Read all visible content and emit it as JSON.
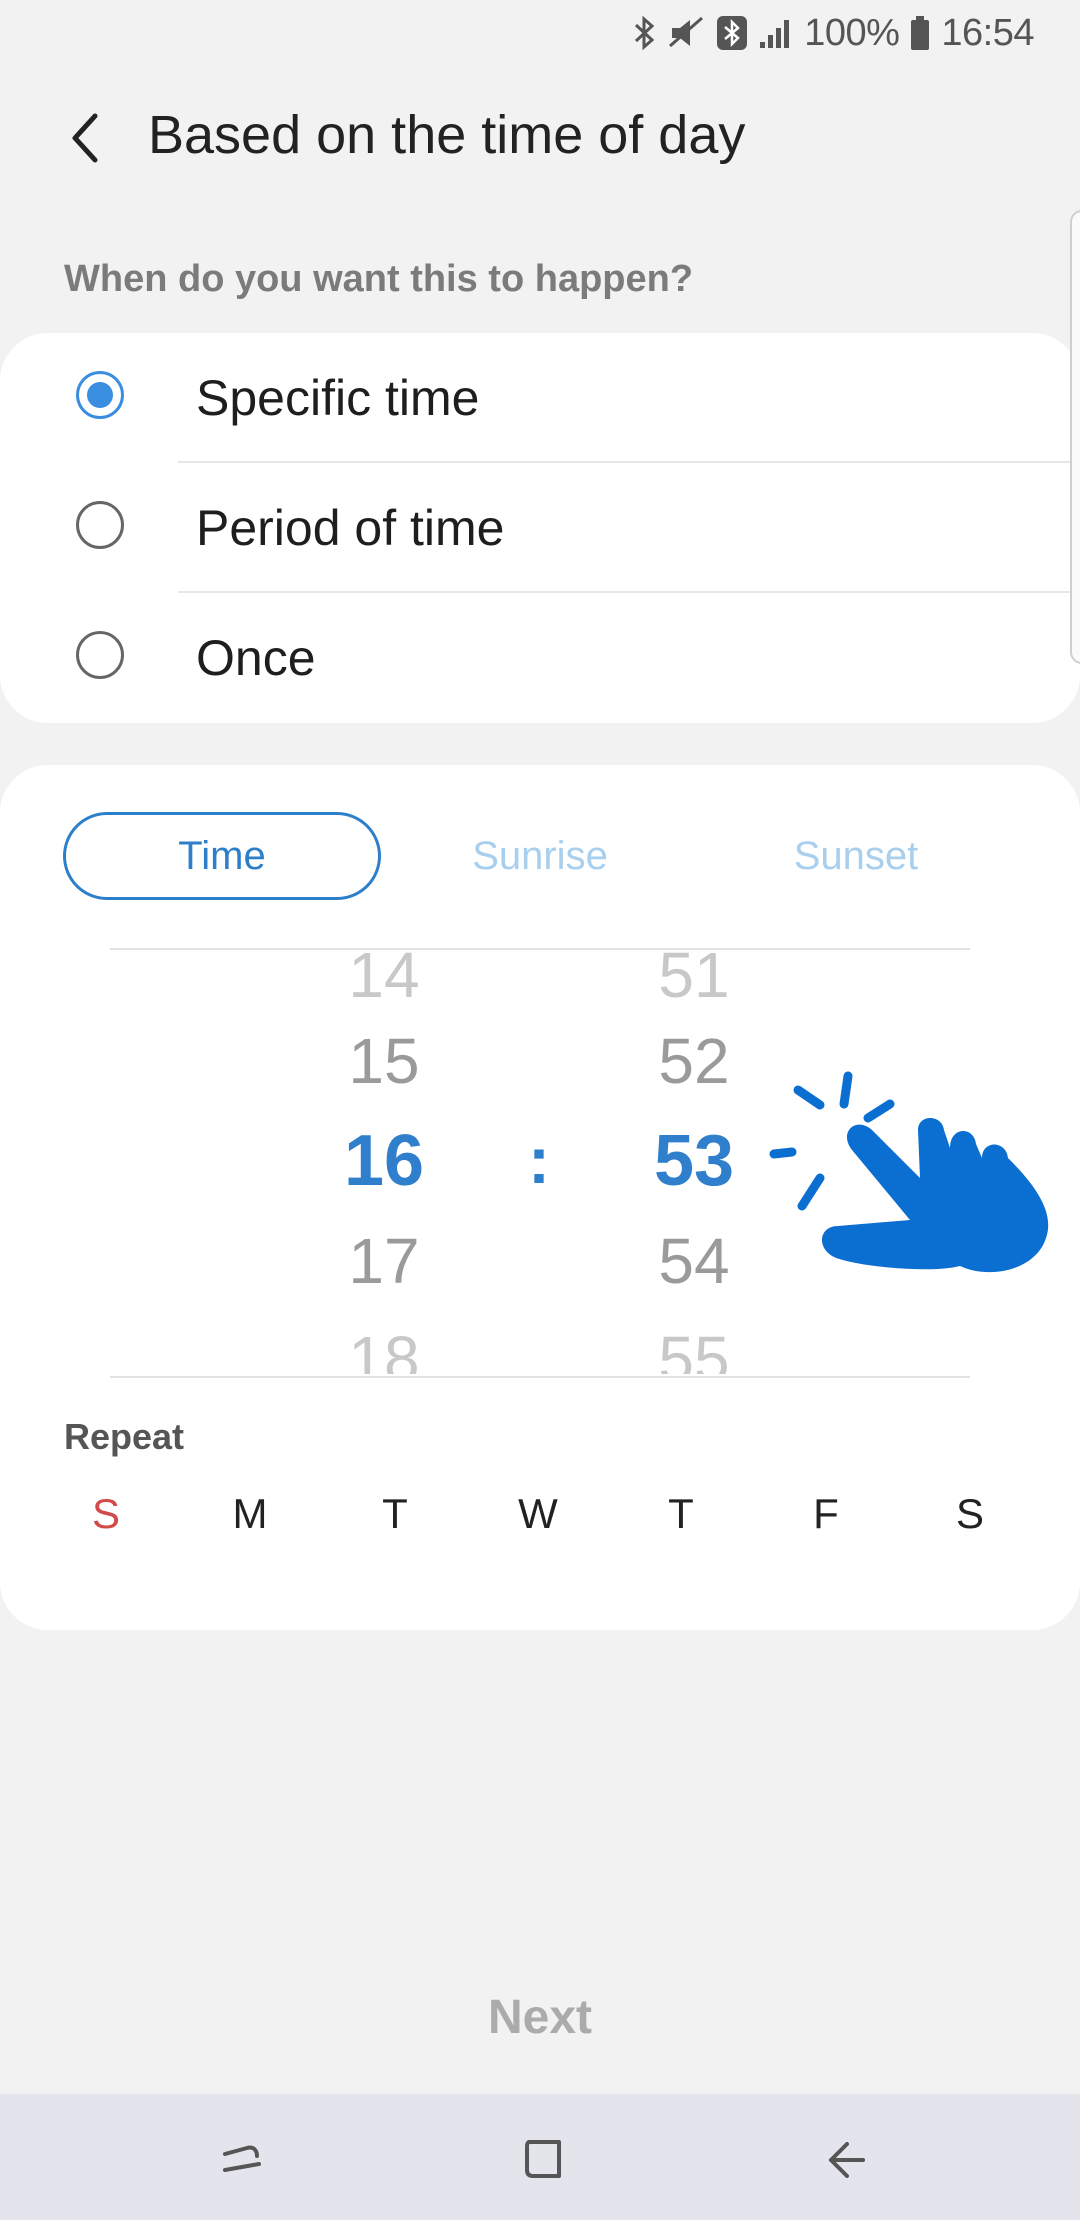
{
  "status_bar": {
    "battery_percent": "100%",
    "time": "16:54",
    "icons": [
      "bluetooth-icon",
      "mute-vibrate-icon",
      "bluetooth-box-icon",
      "signal-icon",
      "battery-icon"
    ]
  },
  "header": {
    "back_icon": "chevron-left-icon",
    "title": "Based on the time of day"
  },
  "question": "When do you want this to happen?",
  "options": [
    {
      "label": "Specific time",
      "selected": true
    },
    {
      "label": "Period of time",
      "selected": false
    },
    {
      "label": "Once",
      "selected": false
    }
  ],
  "mode_tabs": [
    {
      "label": "Time",
      "active": true
    },
    {
      "label": "Sunrise",
      "active": false
    },
    {
      "label": "Sunset",
      "active": false
    }
  ],
  "time_picker": {
    "hours": [
      "14",
      "15",
      "16",
      "17",
      "18"
    ],
    "minutes": [
      "51",
      "52",
      "53",
      "54",
      "55"
    ],
    "selected_hour": "16",
    "selected_minute": "53",
    "separator": ":",
    "gesture_icon": "tap-hand-icon"
  },
  "repeat": {
    "label": "Repeat",
    "days": [
      "S",
      "M",
      "T",
      "W",
      "T",
      "F",
      "S"
    ]
  },
  "next_label": "Next",
  "nav_bar": {
    "icons": [
      "recent-apps-icon",
      "home-icon",
      "back-arrow-icon"
    ]
  },
  "colors": {
    "accent": "#3a8ee0",
    "sunday": "#d24a4a",
    "hand": "#0b6fd1"
  }
}
